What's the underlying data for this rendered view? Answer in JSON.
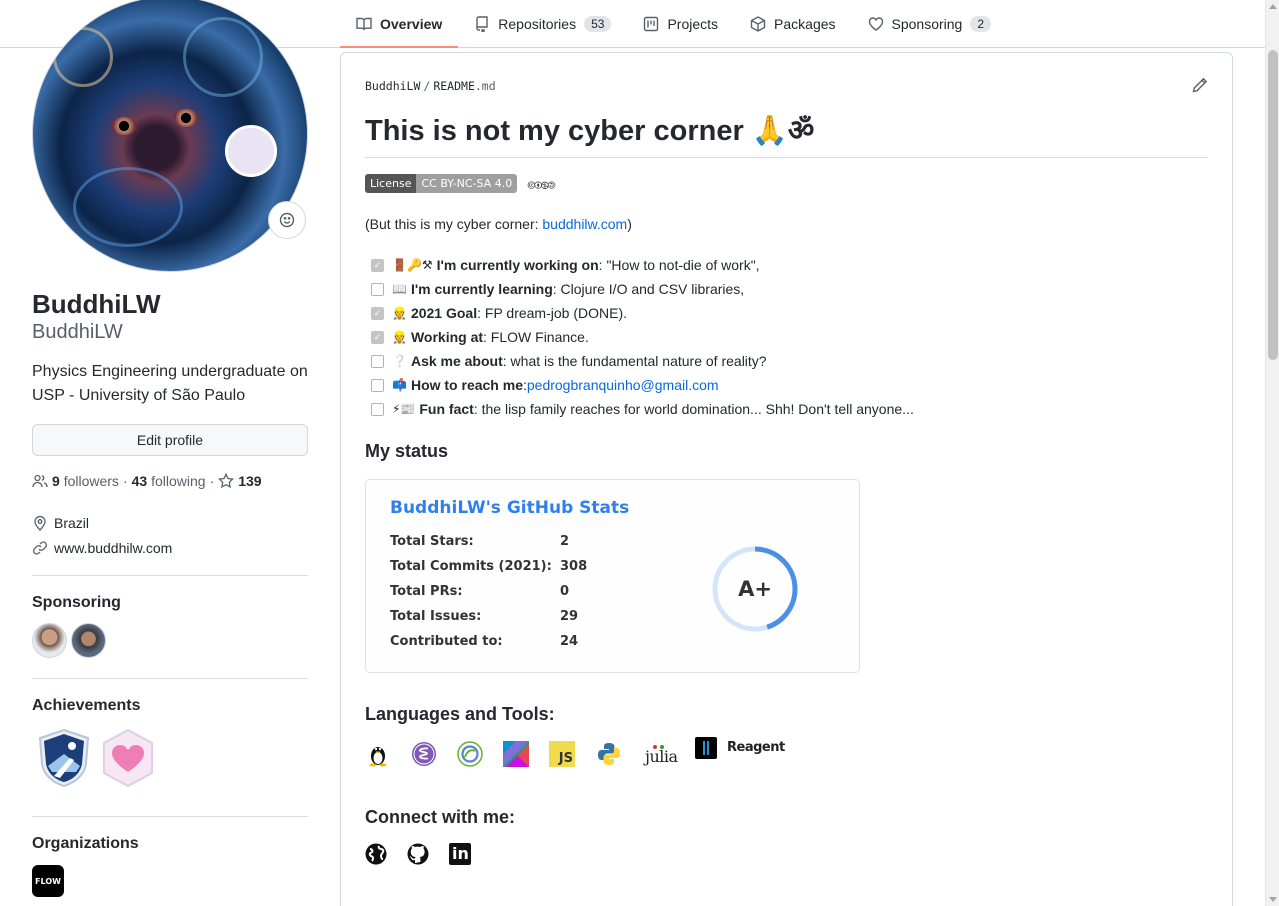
{
  "tabs": [
    {
      "label": "Overview",
      "active": true,
      "icon": "book-icon"
    },
    {
      "label": "Repositories",
      "count": "53",
      "icon": "repo-icon"
    },
    {
      "label": "Projects",
      "icon": "project-icon"
    },
    {
      "label": "Packages",
      "icon": "package-icon"
    },
    {
      "label": "Sponsoring",
      "count": "2",
      "icon": "heart-icon"
    }
  ],
  "profile": {
    "fullname": "BuddhiLW",
    "login": "BuddhiLW",
    "bio": "Physics Engineering undergraduate on USP - University of São Paulo",
    "edit_label": "Edit profile",
    "followers_count": "9",
    "followers_label": "followers",
    "following_count": "43",
    "following_label": "following",
    "stars_count": "139",
    "location": "Brazil",
    "website": "www.buddhilw.com"
  },
  "sidebar": {
    "sponsoring_title": "Sponsoring",
    "achievements_title": "Achievements",
    "organizations_title": "Organizations",
    "org_logo_text": "FLOW"
  },
  "readme": {
    "path_user": "BuddhiLW",
    "path_sep": "/",
    "path_file": "README",
    "path_ext": ".md",
    "title": "This is not my cyber corner 🙏ॐ",
    "license_label": "License",
    "license_value": "CC BY-NC-SA 4.0",
    "cc_icons": "🅭🅯🄏🄎",
    "intro_prefix": "(But this is my cyber corner: ",
    "intro_link": "buddhilw.com",
    "intro_suffix": ")",
    "tasks": [
      {
        "checked": true,
        "emoji": "🚪🔑⚒",
        "bold": "I'm currently working on",
        "text": ": \"How to not-die of work\","
      },
      {
        "checked": false,
        "emoji": "📖",
        "bold": "I'm currently learning",
        "text": ": Clojure I/O and CSV libraries,"
      },
      {
        "checked": true,
        "emoji": "👷",
        "bold": "2021 Goal",
        "text": ": FP dream-job (DONE)."
      },
      {
        "checked": true,
        "emoji": "👷",
        "bold": "Working at",
        "text": ": FLOW Finance."
      },
      {
        "checked": false,
        "emoji": "❔",
        "bold": "Ask me about",
        "text": ": what is the fundamental nature of reality?"
      },
      {
        "checked": false,
        "emoji": "📫",
        "bold": "How to reach me",
        "text": ": ",
        "link": "pedrogbranquinho@gmail.com"
      },
      {
        "checked": false,
        "emoji": "⚡📰",
        "bold": "Fun fact",
        "text": ": the lisp family reaches for world domination... Shh! Don't tell anyone..."
      }
    ],
    "status_title": "My status",
    "stats": {
      "title": "BuddhiLW's GitHub Stats",
      "rows": [
        {
          "label": "Total Stars:",
          "value": "2"
        },
        {
          "label": "Total Commits (2021):",
          "value": "308"
        },
        {
          "label": "Total PRs:",
          "value": "0"
        },
        {
          "label": "Total Issues:",
          "value": "29"
        },
        {
          "label": "Contributed to:",
          "value": "24"
        }
      ],
      "rank": "A+",
      "rank_progress": 0.45
    },
    "languages_title": "Languages and Tools:",
    "languages": [
      "linux-icon",
      "emacs-icon",
      "clojure-icon",
      "kotlin-icon",
      "javascript-icon",
      "python-icon",
      "julia-icon",
      "reagent-icon"
    ],
    "js_text": "JS",
    "julia_text": "julia",
    "reagent_text": "Reagent",
    "connect_title": "Connect with me:",
    "connect": [
      "globe-icon",
      "github-icon",
      "linkedin-icon"
    ],
    "linkedin_text": "in"
  },
  "colors": {
    "accent": "#fd8c73",
    "link": "#0969da",
    "stats_title": "#2f80ed"
  }
}
